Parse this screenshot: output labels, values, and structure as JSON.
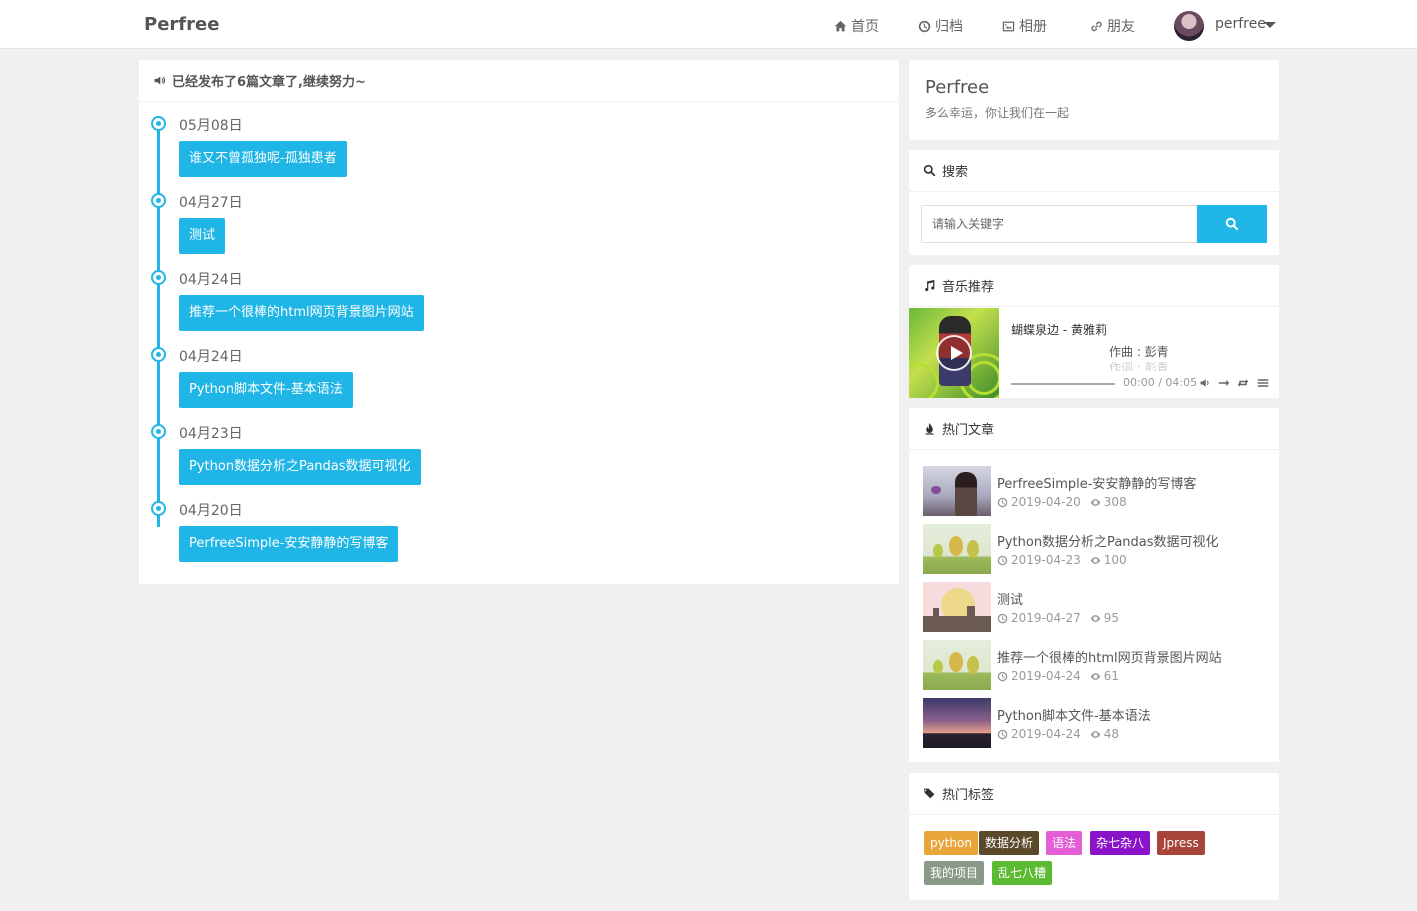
{
  "header": {
    "brand": "Perfree",
    "nav": [
      {
        "label": "首页",
        "icon": "home-icon"
      },
      {
        "label": "归档",
        "icon": "clock-icon"
      },
      {
        "label": "相册",
        "icon": "image-icon"
      },
      {
        "label": "朋友",
        "icon": "link-icon"
      }
    ],
    "user": "perfree"
  },
  "notice": "已经发布了6篇文章了,继续努力~",
  "timeline": [
    {
      "date": "05月08日",
      "title": "谁又不曾孤独呢-孤独患者"
    },
    {
      "date": "04月27日",
      "title": "测试"
    },
    {
      "date": "04月24日",
      "title": "推荐一个很棒的html网页背景图片网站"
    },
    {
      "date": "04月24日",
      "title": "Python脚本文件-基本语法"
    },
    {
      "date": "04月23日",
      "title": "Python数据分析之Pandas数据可视化"
    },
    {
      "date": "04月20日",
      "title": "PerfreeSimple-安安静静的写博客"
    }
  ],
  "about": {
    "title": "Perfree",
    "subtitle": "多么幸运，你让我们在一起"
  },
  "search": {
    "title": "搜索",
    "placeholder": "请输入关键字"
  },
  "music": {
    "title": "音乐推荐",
    "song": "蝴蝶泉边 - 黄雅莉",
    "lyric_current": "作曲 : 彭青",
    "lyric_next": "作词 : 彭青",
    "time": "00:00 / 04:05"
  },
  "hot": {
    "title": "热门文章",
    "items": [
      {
        "title": "PerfreeSimple-安安静静的写博客",
        "date": "2019-04-20",
        "views": "308"
      },
      {
        "title": "Python数据分析之Pandas数据可视化",
        "date": "2019-04-23",
        "views": "100"
      },
      {
        "title": "测试",
        "date": "2019-04-27",
        "views": "95"
      },
      {
        "title": "推荐一个很棒的html网页背景图片网站",
        "date": "2019-04-24",
        "views": "61"
      },
      {
        "title": "Python脚本文件-基本语法",
        "date": "2019-04-24",
        "views": "48"
      }
    ]
  },
  "tags": {
    "title": "热门标签",
    "items": [
      {
        "label": "python",
        "color": "#e8a53a"
      },
      {
        "label": "数据分析",
        "color": "#5a4a2a"
      },
      {
        "label": "语法",
        "color": "#e45fd6"
      },
      {
        "label": "杂七杂八",
        "color": "#8a12c8"
      },
      {
        "label": "Jpress",
        "color": "#a8443a"
      },
      {
        "label": "我的项目",
        "color": "#8a9a88"
      },
      {
        "label": "乱七八糟",
        "color": "#5cba32"
      }
    ]
  }
}
